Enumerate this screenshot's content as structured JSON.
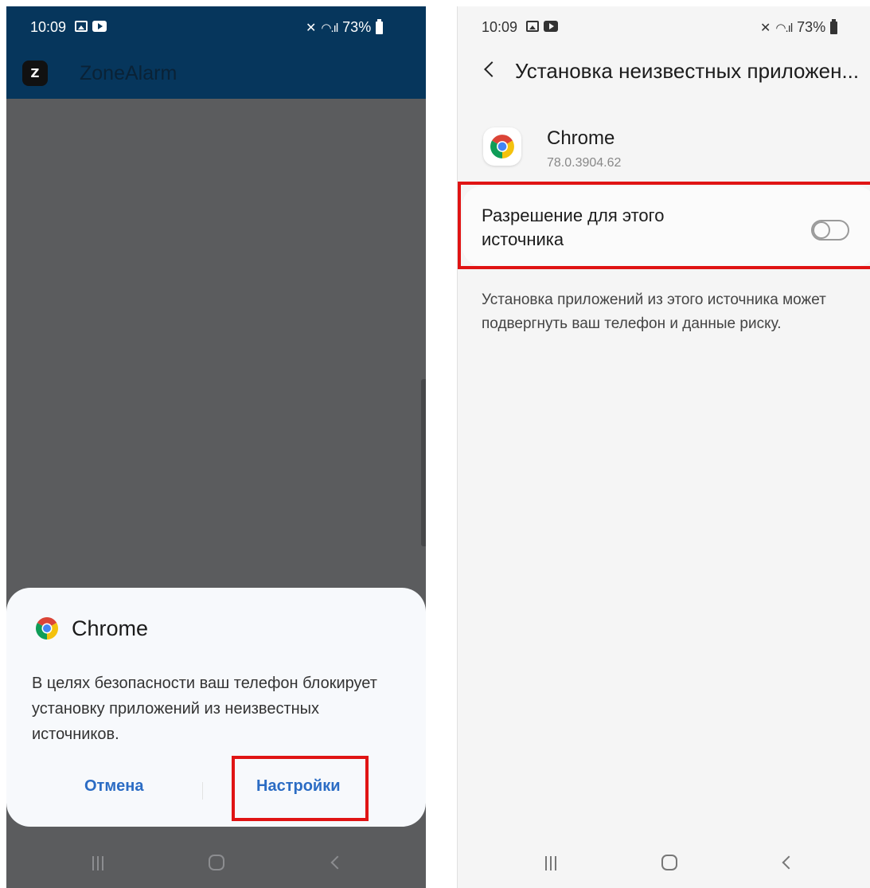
{
  "left_screen": {
    "status_bar": {
      "time": "10:09",
      "battery": "73%"
    },
    "app_bar": {
      "logo_letter": "Z",
      "app_name": "ZoneAlarm"
    },
    "dialog": {
      "app_name": "Chrome",
      "message": "В целях безопасности ваш телефон блокирует установку приложений из неизвестных источников.",
      "cancel_label": "Отмена",
      "settings_label": "Настройки"
    },
    "highlight_color": "#e01414"
  },
  "right_screen": {
    "status_bar": {
      "time": "10:09",
      "battery": "73%"
    },
    "page_title": "Установка неизвестных приложен...",
    "app": {
      "name": "Chrome",
      "version": "78.0.3904.62"
    },
    "permission": {
      "label": "Разрешение для этого источника",
      "enabled": false
    },
    "warning": "Установка приложений из этого источника может подвергнуть ваш телефон и данные риску.",
    "highlight_color": "#e01414"
  },
  "colors": {
    "app_bar": "#06365c",
    "dim_overlay": "#5b5c5e",
    "accent_blue": "#2b6cc4",
    "highlight_red": "#e01414"
  },
  "icons": [
    "gallery-icon",
    "video-icon",
    "mute-icon",
    "wifi-icon",
    "signal-icon",
    "battery-icon",
    "chrome-icon",
    "back-arrow-icon",
    "recent-apps-icon",
    "home-icon",
    "back-icon"
  ]
}
